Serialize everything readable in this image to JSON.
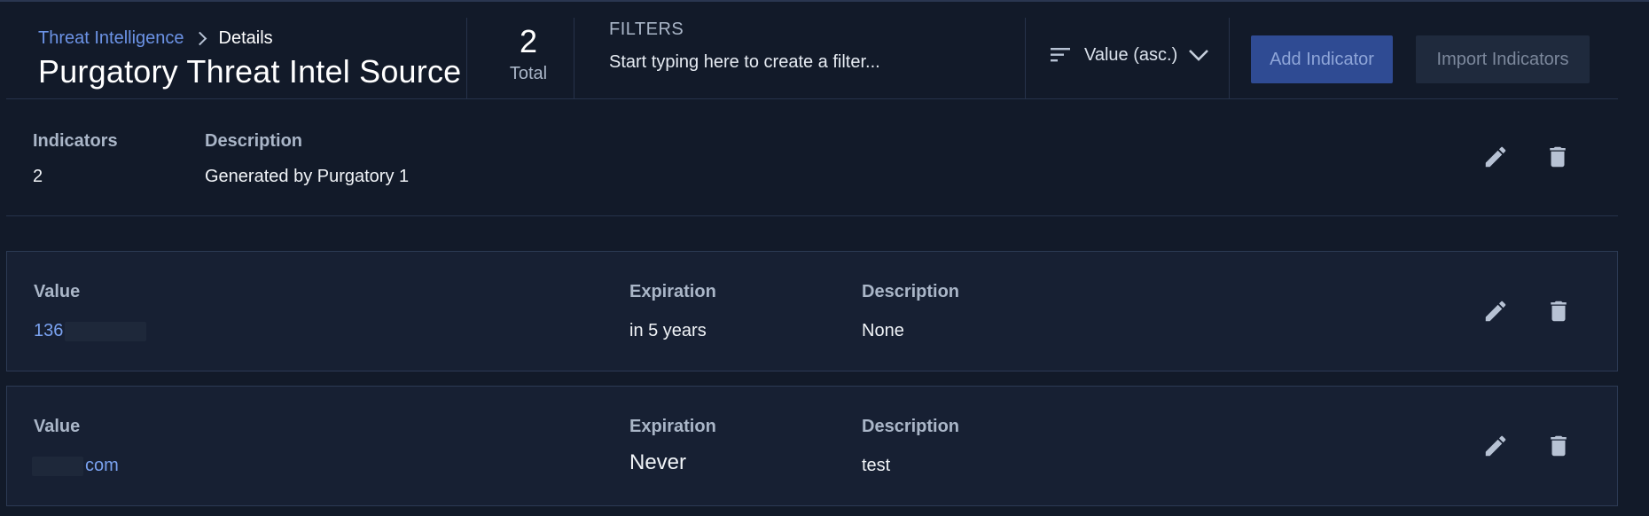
{
  "header": {
    "breadcrumb": {
      "parent": "Threat Intelligence",
      "current": "Details"
    },
    "title": "Purgatory Threat Intel Source",
    "total": {
      "count": "2",
      "label": "Total"
    },
    "filters": {
      "label": "FILTERS",
      "placeholder": "Start typing here to create a filter..."
    },
    "sort": {
      "label": "Value (asc.)",
      "icon": "sort-lines-icon"
    },
    "buttons": {
      "add": "Add Indicator",
      "import": "Import Indicators"
    }
  },
  "source": {
    "indicators_label": "Indicators",
    "indicators_value": "2",
    "description_label": "Description",
    "description_value": "Generated by Purgatory 1"
  },
  "indicators": [
    {
      "value_label": "Value",
      "value": "136",
      "expiration_label": "Expiration",
      "expiration": "in 5 years",
      "description_label": "Description",
      "description": "None"
    },
    {
      "value_label": "Value",
      "value": "com",
      "expiration_label": "Expiration",
      "expiration": "Never",
      "description_label": "Description",
      "description": "test"
    }
  ],
  "colors": {
    "background": "#121a29",
    "card": "#172033",
    "link": "#6c93e6",
    "primary_button": "#2f4b93"
  }
}
